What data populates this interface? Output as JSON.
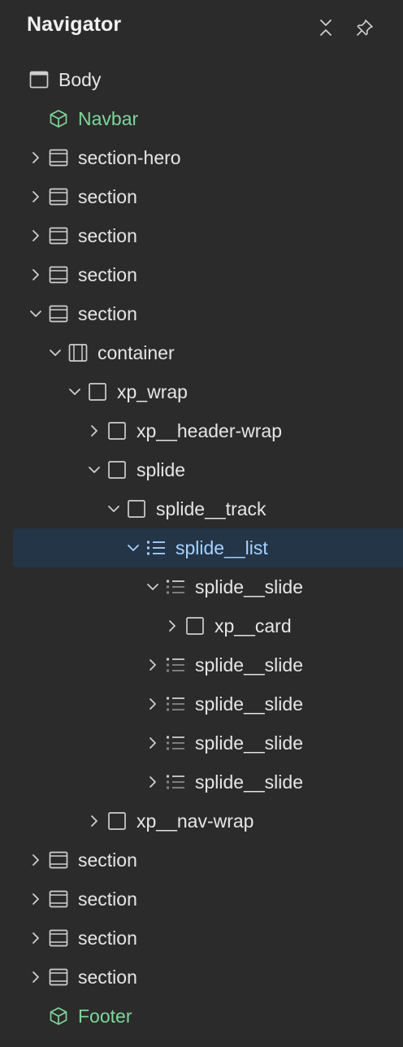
{
  "panel": {
    "title": "Navigator"
  },
  "tree": {
    "items": [
      {
        "label": "Body",
        "icon": "body-icon",
        "type": "body",
        "depth": 0,
        "caret": "none"
      },
      {
        "label": "Navbar",
        "icon": "component-icon",
        "type": "component",
        "depth": 1,
        "caret": "none"
      },
      {
        "label": "section-hero",
        "icon": "section-icon",
        "type": "section",
        "depth": 1,
        "caret": "collapsed"
      },
      {
        "label": "section",
        "icon": "section-icon",
        "type": "section",
        "depth": 1,
        "caret": "collapsed"
      },
      {
        "label": "section",
        "icon": "section-icon",
        "type": "section",
        "depth": 1,
        "caret": "collapsed"
      },
      {
        "label": "section",
        "icon": "section-icon",
        "type": "section",
        "depth": 1,
        "caret": "collapsed"
      },
      {
        "label": "section",
        "icon": "section-icon",
        "type": "section",
        "depth": 1,
        "caret": "expanded"
      },
      {
        "label": "container",
        "icon": "container-icon",
        "type": "container",
        "depth": 2,
        "caret": "expanded"
      },
      {
        "label": "xp_wrap",
        "icon": "div-block-icon",
        "type": "div",
        "depth": 3,
        "caret": "expanded"
      },
      {
        "label": "xp__header-wrap",
        "icon": "div-block-icon",
        "type": "div",
        "depth": 4,
        "caret": "collapsed"
      },
      {
        "label": "splide",
        "icon": "div-block-icon",
        "type": "div",
        "depth": 4,
        "caret": "expanded"
      },
      {
        "label": "splide__track",
        "icon": "div-block-icon",
        "type": "div",
        "depth": 5,
        "caret": "expanded"
      },
      {
        "label": "splide__list",
        "icon": "list-icon",
        "type": "list",
        "depth": 6,
        "caret": "expanded",
        "selected": true
      },
      {
        "label": "splide__slide",
        "icon": "list-item-icon",
        "type": "list-item",
        "depth": 7,
        "caret": "expanded"
      },
      {
        "label": "xp__card",
        "icon": "div-block-icon",
        "type": "div",
        "depth": 8,
        "caret": "collapsed"
      },
      {
        "label": "splide__slide",
        "icon": "list-item-icon",
        "type": "list-item",
        "depth": 7,
        "caret": "collapsed"
      },
      {
        "label": "splide__slide",
        "icon": "list-item-icon",
        "type": "list-item",
        "depth": 7,
        "caret": "collapsed"
      },
      {
        "label": "splide__slide",
        "icon": "list-item-icon",
        "type": "list-item",
        "depth": 7,
        "caret": "collapsed"
      },
      {
        "label": "splide__slide",
        "icon": "list-item-icon",
        "type": "list-item",
        "depth": 7,
        "caret": "collapsed"
      },
      {
        "label": "xp__nav-wrap",
        "icon": "div-block-icon",
        "type": "div",
        "depth": 4,
        "caret": "collapsed"
      },
      {
        "label": "section",
        "icon": "section-icon",
        "type": "section",
        "depth": 1,
        "caret": "collapsed"
      },
      {
        "label": "section",
        "icon": "section-icon",
        "type": "section",
        "depth": 1,
        "caret": "collapsed"
      },
      {
        "label": "section",
        "icon": "section-icon",
        "type": "section",
        "depth": 1,
        "caret": "collapsed"
      },
      {
        "label": "section",
        "icon": "section-icon",
        "type": "section",
        "depth": 1,
        "caret": "collapsed"
      },
      {
        "label": "Footer",
        "icon": "component-icon",
        "type": "component",
        "depth": 1,
        "caret": "none"
      }
    ]
  },
  "colors": {
    "background": "#2b2b2b",
    "text": "#e6e6e6",
    "component": "#7ed69a",
    "selected_text": "#a6d2ff",
    "selected_bg": "#243547",
    "icon": "#cfcfcf"
  }
}
